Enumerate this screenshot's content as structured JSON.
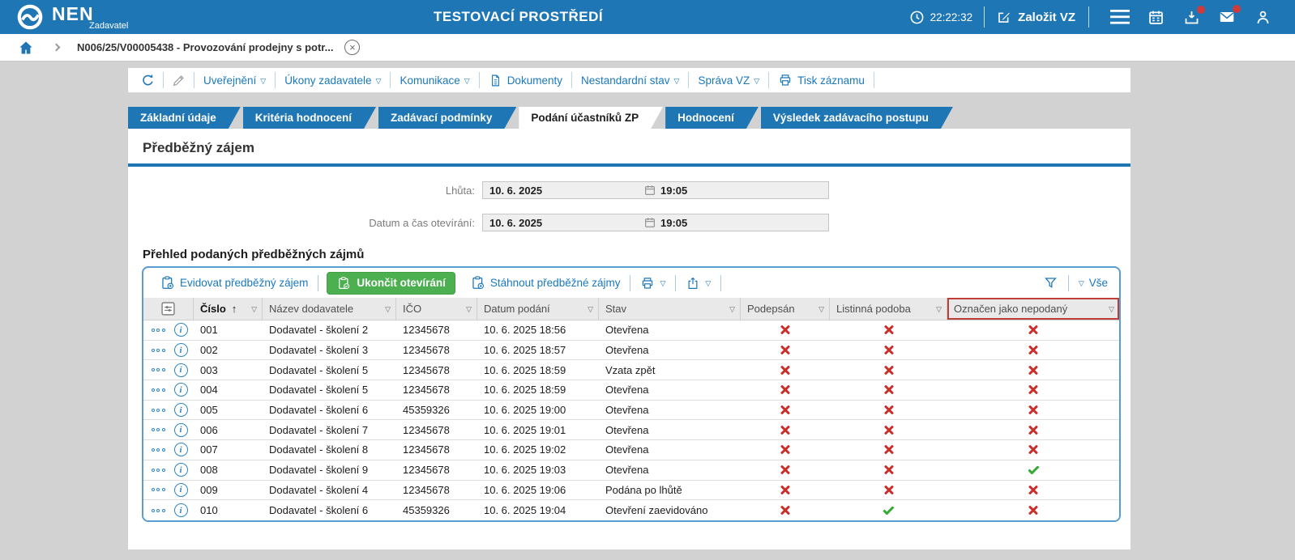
{
  "topbar": {
    "brand": "NEN",
    "brand_sub": "Zadavatel",
    "env_title": "TESTOVACÍ PROSTŘEDÍ",
    "clock": "22:22:32",
    "create_vz": "Založit VZ",
    "icons": [
      "clock-icon",
      "edit-icon",
      "menu-icon",
      "calendar-icon",
      "download-icon",
      "mail-icon",
      "user-icon"
    ],
    "download_badge": true,
    "mail_badge": true
  },
  "breadcrumb": {
    "item": "N006/25/V00005438 - Provozování prodejny s potr..."
  },
  "actions_toolbar": {
    "icon_buttons": [
      "refresh-icon",
      "pencil-icon"
    ],
    "items": [
      {
        "label": "Uveřejnění",
        "caret": true
      },
      {
        "label": "Úkony zadavatele",
        "caret": true
      },
      {
        "label": "Komunikace",
        "caret": true
      },
      {
        "label": "Dokumenty",
        "caret": false,
        "icon": "document-icon"
      },
      {
        "label": "Nestandardní stav",
        "caret": true
      },
      {
        "label": "Správa VZ",
        "caret": true
      },
      {
        "label": "Tisk záznamu",
        "caret": false,
        "icon": "printer-icon"
      }
    ]
  },
  "tabs": [
    {
      "label": "Základní údaje",
      "active": false
    },
    {
      "label": "Kritéria hodnocení",
      "active": false
    },
    {
      "label": "Zadávací podmínky",
      "active": false
    },
    {
      "label": "Podání účastníků ZP",
      "active": true
    },
    {
      "label": "Hodnocení",
      "active": false
    },
    {
      "label": "Výsledek zadávacího postupu",
      "active": false
    }
  ],
  "section": {
    "title": "Předběžný zájem"
  },
  "form": {
    "rows": [
      {
        "label": "Lhůta:",
        "date": "10. 6. 2025",
        "time": "19:05"
      },
      {
        "label": "Datum a čas otevírání:",
        "date": "10. 6. 2025",
        "time": "19:05"
      }
    ]
  },
  "table": {
    "title": "Přehled podaných předběžných zájmů",
    "toolbar": {
      "evidovat": "Evidovat předběžný zájem",
      "ukoncit": "Ukončit otevírání",
      "stahnout": "Stáhnout předběžné zájmy",
      "filter_all": "Vše",
      "icons": [
        "clipboard-gear-icon",
        "clipboard-check-icon",
        "clipboard-download-icon",
        "printer-icon",
        "share-icon",
        "funnel-icon"
      ]
    },
    "columns": [
      {
        "key": "cislo",
        "label": "Číslo",
        "sort": "asc"
      },
      {
        "key": "nazev",
        "label": "Název dodavatele"
      },
      {
        "key": "ico",
        "label": "IČO"
      },
      {
        "key": "datum",
        "label": "Datum podání"
      },
      {
        "key": "stav",
        "label": "Stav"
      },
      {
        "key": "podepsan",
        "label": "Podepsán"
      },
      {
        "key": "listinna",
        "label": "Listinná podoba"
      },
      {
        "key": "nepodany",
        "label": "Označen jako nepodaný",
        "flagged": true
      }
    ],
    "rows": [
      {
        "cislo": "001",
        "nazev": "Dodavatel - školení 2",
        "ico": "12345678",
        "datum": "10. 6. 2025 18:56",
        "stav": "Otevřena",
        "podepsan": false,
        "listinna": false,
        "nepodany": false
      },
      {
        "cislo": "002",
        "nazev": "Dodavatel - školení 3",
        "ico": "12345678",
        "datum": "10. 6. 2025 18:57",
        "stav": "Otevřena",
        "podepsan": false,
        "listinna": false,
        "nepodany": false
      },
      {
        "cislo": "003",
        "nazev": "Dodavatel - školení 5",
        "ico": "12345678",
        "datum": "10. 6. 2025 18:59",
        "stav": "Vzata zpět",
        "podepsan": false,
        "listinna": false,
        "nepodany": false
      },
      {
        "cislo": "004",
        "nazev": "Dodavatel - školení 5",
        "ico": "12345678",
        "datum": "10. 6. 2025 18:59",
        "stav": "Otevřena",
        "podepsan": false,
        "listinna": false,
        "nepodany": false
      },
      {
        "cislo": "005",
        "nazev": "Dodavatel - školení 6",
        "ico": "45359326",
        "datum": "10. 6. 2025 19:00",
        "stav": "Otevřena",
        "podepsan": false,
        "listinna": false,
        "nepodany": false
      },
      {
        "cislo": "006",
        "nazev": "Dodavatel - školení 7",
        "ico": "12345678",
        "datum": "10. 6. 2025 19:01",
        "stav": "Otevřena",
        "podepsan": false,
        "listinna": false,
        "nepodany": false
      },
      {
        "cislo": "007",
        "nazev": "Dodavatel - školení 8",
        "ico": "12345678",
        "datum": "10. 6. 2025 19:02",
        "stav": "Otevřena",
        "podepsan": false,
        "listinna": false,
        "nepodany": false
      },
      {
        "cislo": "008",
        "nazev": "Dodavatel - školení 9",
        "ico": "12345678",
        "datum": "10. 6. 2025 19:03",
        "stav": "Otevřena",
        "podepsan": false,
        "listinna": false,
        "nepodany": true
      },
      {
        "cislo": "009",
        "nazev": "Dodavatel - školení 4",
        "ico": "12345678",
        "datum": "10. 6. 2025 19:06",
        "stav": "Podána po lhůtě",
        "podepsan": false,
        "listinna": false,
        "nepodany": false
      },
      {
        "cislo": "010",
        "nazev": "Dodavatel - školení 6",
        "ico": "45359326",
        "datum": "10. 6. 2025 19:04",
        "stav": "Otevření zaevidováno",
        "podepsan": false,
        "listinna": true,
        "nepodany": false
      }
    ]
  },
  "colors": {
    "topbar_blue": "#1f76b4",
    "link_blue": "#1a78bd",
    "green_button": "#4caf50",
    "cross_red": "#c9302c",
    "check_green": "#35a935",
    "badge_red": "#cf3a3a",
    "flag_border_red": "#bd3e37",
    "header_gray": "#e9e9e9"
  }
}
